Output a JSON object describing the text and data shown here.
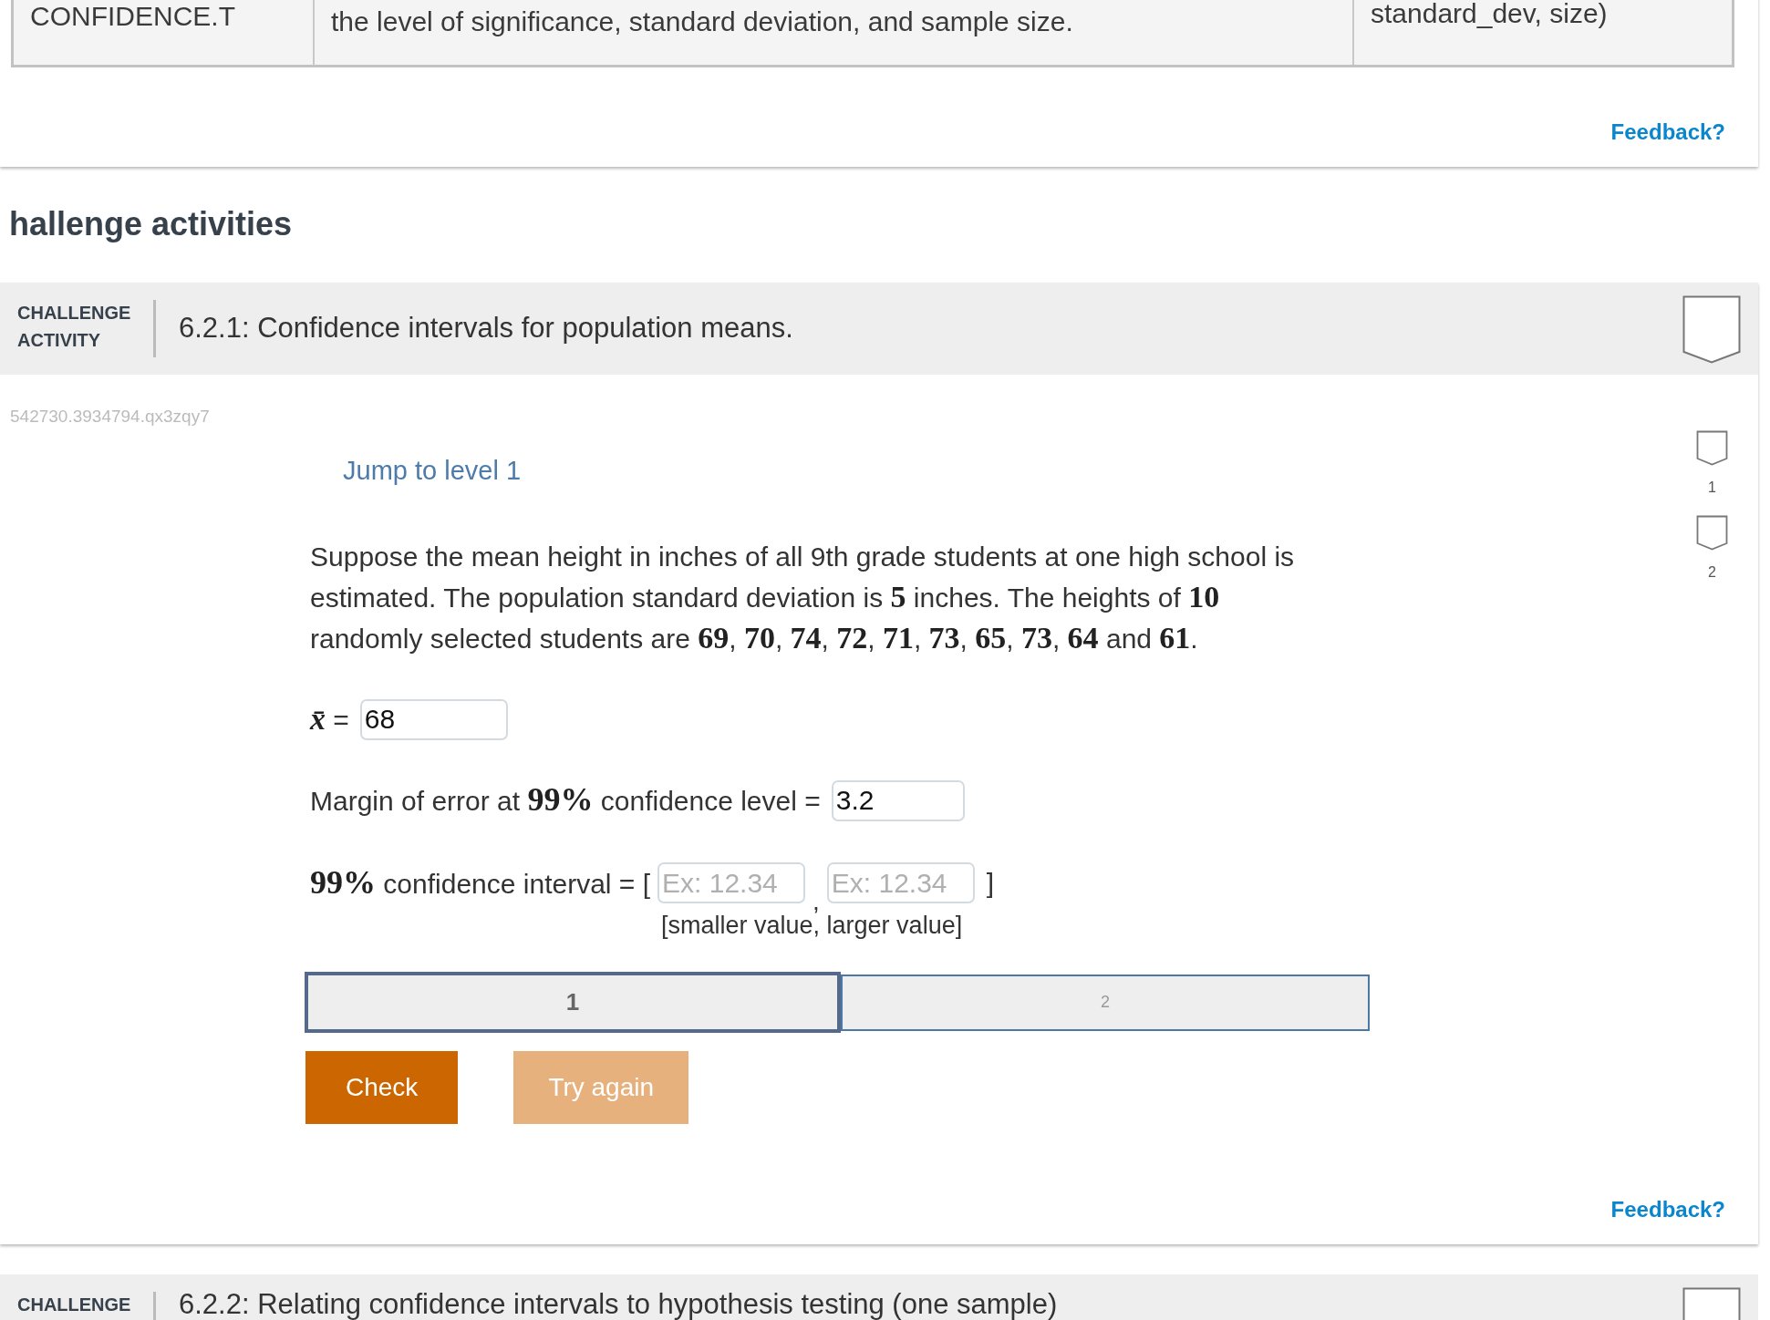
{
  "reference_card": {
    "table_row": [
      "CONFIDENCE.T",
      "the level of significance, standard deviation, and sample size.",
      "standard_dev, size)"
    ],
    "feedback": "Feedback?"
  },
  "section_heading": "hallenge activities",
  "activities": [
    {
      "label": "CHALLENGE ACTIVITY",
      "title": "6.2.1: Confidence intervals for population means.",
      "completed": false,
      "code": "542730.3934794.qx3zqy7",
      "jump_link": "Jump to level 1",
      "levels": [
        {
          "label": "1",
          "completed": false
        },
        {
          "label": "2",
          "completed": false
        }
      ],
      "prompt": "Suppose the mean height in inches of all 9th grade students at one high school is estimated. The population standard deviation is **5** inches. The heights of **10** randomly selected students are **69**, **70**, **74**, **72**, **71**, **73**, **65**, **73**, **64** and **61**.",
      "answers": [
        {
          "kind": "single",
          "label": "*x̄* =",
          "value": "68"
        },
        {
          "kind": "single",
          "label": "Margin of error at **99%** confidence level =",
          "value": "3.2"
        },
        {
          "kind": "interval",
          "label": "**99%** confidence interval = [",
          "fields": [
            {
              "placeholder": "Ex: 12.34"
            },
            {
              "placeholder": "Ex: 12.34"
            }
          ],
          "separator": ",",
          "close": "]",
          "hint": "[smaller value, larger value]"
        }
      ],
      "level_tabs": [
        {
          "label": "1",
          "selected": true
        },
        {
          "label": "2",
          "selected": false
        }
      ],
      "buttons": [
        {
          "label": "Check",
          "disabled": false
        },
        {
          "label": "Try again",
          "disabled": true
        }
      ],
      "feedback": "Feedback?"
    },
    {
      "label": "CHALLENGE",
      "title": "6.2.2: Relating confidence intervals to hypothesis testing (one sample)",
      "completed": false
    }
  ]
}
